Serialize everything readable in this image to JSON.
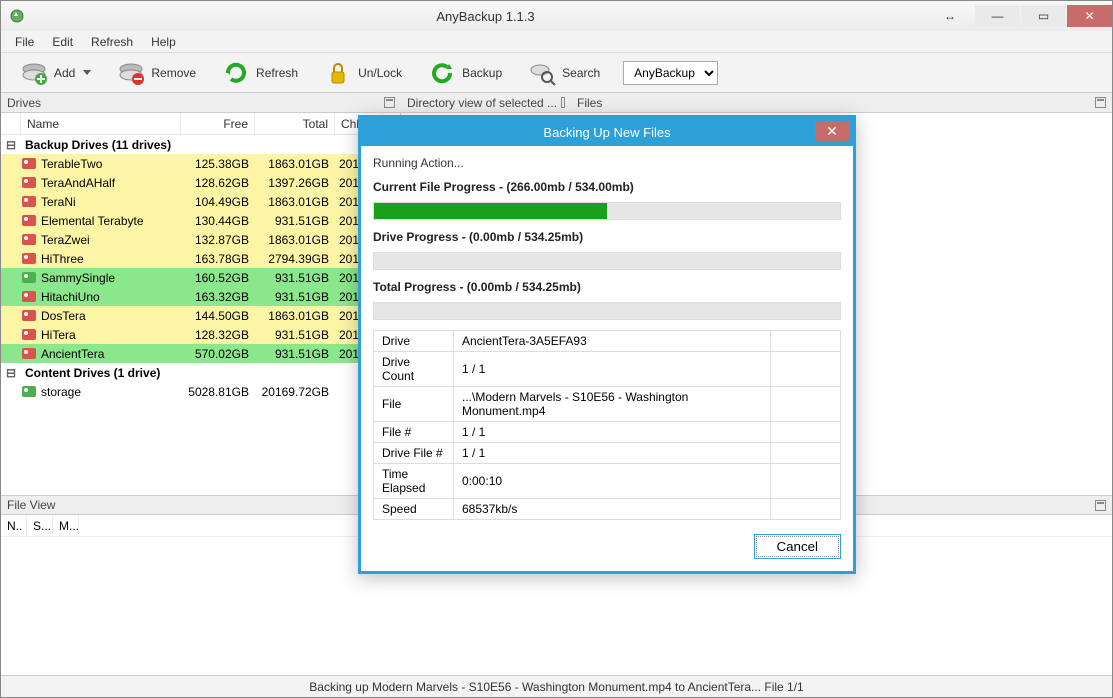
{
  "window": {
    "title": "AnyBackup 1.1.3"
  },
  "menu": {
    "file": "File",
    "edit": "Edit",
    "refresh": "Refresh",
    "help": "Help"
  },
  "toolbar": {
    "add": "Add",
    "remove": "Remove",
    "refresh": "Refresh",
    "unlock": "Un/Lock",
    "backup": "Backup",
    "search": "Search",
    "select_value": "AnyBackup"
  },
  "panes": {
    "drives": "Drives",
    "dir": "Directory view of selected ...",
    "files": "Files"
  },
  "drives_grid": {
    "cols": {
      "name": "Name",
      "free": "Free",
      "total": "Total",
      "chk": "Chk..."
    },
    "group_backup": "Backup Drives (11 drives)",
    "group_content": "Content Drives (1 drive)",
    "rows": [
      {
        "name": "TerableTwo",
        "free": "125.38GB",
        "total": "1863.01GB",
        "chk": "2014",
        "bg": "yellow",
        "icon": "red"
      },
      {
        "name": "TeraAndAHalf",
        "free": "128.62GB",
        "total": "1397.26GB",
        "chk": "2014",
        "bg": "yellow",
        "icon": "red"
      },
      {
        "name": "TeraNi",
        "free": "104.49GB",
        "total": "1863.01GB",
        "chk": "2014",
        "bg": "yellow",
        "icon": "red"
      },
      {
        "name": "Elemental Terabyte",
        "free": "130.44GB",
        "total": "931.51GB",
        "chk": "2014",
        "bg": "yellow",
        "icon": "red"
      },
      {
        "name": "TeraZwei",
        "free": "132.87GB",
        "total": "1863.01GB",
        "chk": "2014",
        "bg": "yellow",
        "icon": "red"
      },
      {
        "name": "HiThree",
        "free": "163.78GB",
        "total": "2794.39GB",
        "chk": "2014",
        "bg": "yellow",
        "icon": "red"
      },
      {
        "name": "SammySingle",
        "free": "160.52GB",
        "total": "931.51GB",
        "chk": "2014",
        "bg": "green",
        "icon": "green"
      },
      {
        "name": "HitachiUno",
        "free": "163.32GB",
        "total": "931.51GB",
        "chk": "2014",
        "bg": "green",
        "icon": "red"
      },
      {
        "name": "DosTera",
        "free": "144.50GB",
        "total": "1863.01GB",
        "chk": "2014",
        "bg": "yellow",
        "icon": "red"
      },
      {
        "name": "HiTera",
        "free": "128.32GB",
        "total": "931.51GB",
        "chk": "2014",
        "bg": "yellow",
        "icon": "red"
      },
      {
        "name": "AncientTera",
        "free": "570.02GB",
        "total": "931.51GB",
        "chk": "2014",
        "bg": "green",
        "icon": "red"
      }
    ],
    "content_rows": [
      {
        "name": "storage",
        "free": "5028.81GB",
        "total": "20169.72GB",
        "chk": "",
        "bg": "white",
        "icon": "green"
      }
    ]
  },
  "fileview": {
    "title": "File View",
    "cols": {
      "n": "N..",
      "s": "S...",
      "m": "M..."
    }
  },
  "status": "Backing up Modern Marvels - S10E56 - Washington Monument.mp4 to AncientTera... File 1/1",
  "dialog": {
    "title": "Backing Up New Files",
    "running": "Running Action...",
    "current_label": "Current File Progress - (266.00mb / 534.00mb)",
    "current_pct": 50,
    "drive_label": "Drive Progress - (0.00mb / 534.25mb)",
    "drive_pct": 0,
    "total_label": "Total Progress - (0.00mb / 534.25mb)",
    "total_pct": 0,
    "info": {
      "k_drive": "Drive",
      "v_drive": "AncientTera-3A5EFA93",
      "k_dcount": "Drive Count",
      "v_dcount": "1 / 1",
      "k_file": "File",
      "v_file": "...\\Modern Marvels - S10E56 - Washington Monument.mp4",
      "k_fnum": "File #",
      "v_fnum": "1 / 1",
      "k_dfnum": "Drive File #",
      "v_dfnum": "1 / 1",
      "k_time": "Time Elapsed",
      "v_time": "0:00:10",
      "k_speed": "Speed",
      "v_speed": "68537kb/s"
    },
    "cancel": "Cancel"
  }
}
